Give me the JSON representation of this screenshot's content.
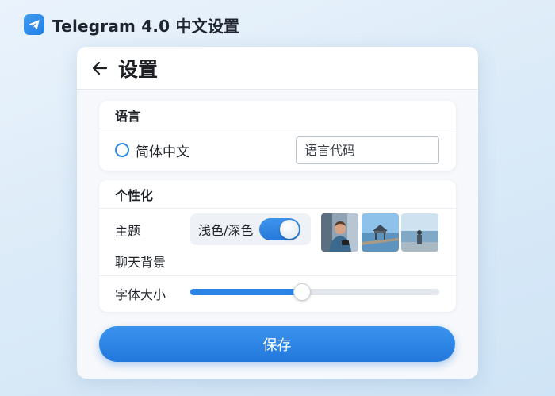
{
  "app": {
    "title": "Telegram 4.0 中文设置",
    "logo_icon": "telegram-plane-icon",
    "accent_color": "#2b86e8"
  },
  "header": {
    "back_icon": "arrow-left-icon",
    "title": "设置"
  },
  "language": {
    "section_title": "语言",
    "option_label": "简体中文",
    "option_selected": false,
    "code_input_value": "",
    "code_input_placeholder": "语言代码"
  },
  "personalization": {
    "section_title": "个性化",
    "theme_label": "主题",
    "theme_toggle_label": "浅色/深色",
    "theme_toggle_on": true,
    "background_label": "聊天背景",
    "background_thumbnails": [
      {
        "name": "man-with-phone-thumbnail"
      },
      {
        "name": "pier-pavilion-thumbnail"
      },
      {
        "name": "person-on-beach-thumbnail"
      }
    ],
    "font_size_label": "字体大小",
    "font_size_fraction": 0.45
  },
  "actions": {
    "save_label": "保存"
  }
}
